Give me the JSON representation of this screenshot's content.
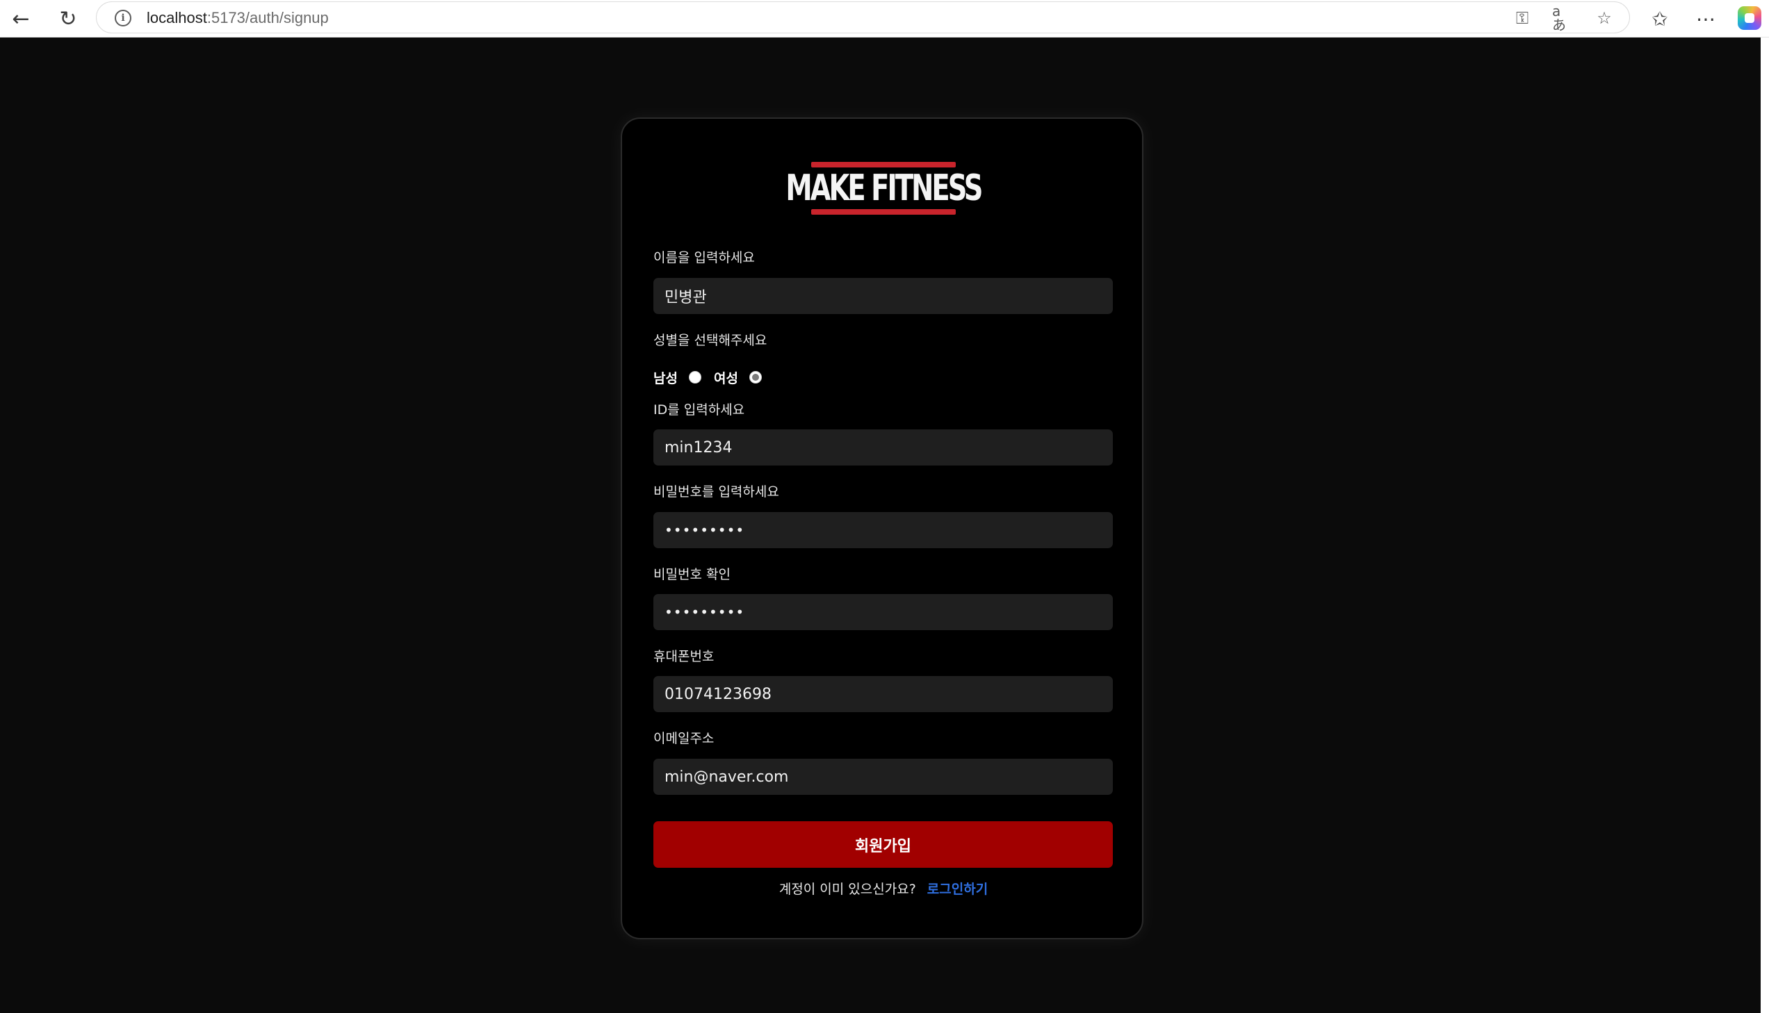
{
  "browser": {
    "url_host": "localhost",
    "url_path": ":5173/auth/signup",
    "back_icon": "back-arrow-icon",
    "reload_icon": "reload-icon",
    "info_glyph": "i"
  },
  "logo": {
    "text": "MAKE FITNESS",
    "accent_color": "#c9242c"
  },
  "form": {
    "name": {
      "label": "이름을 입력하세요",
      "value": "민병관"
    },
    "gender": {
      "label": "성별을 선택해주세요",
      "male_label": "남성",
      "female_label": "여성",
      "selected": "여성"
    },
    "id": {
      "label": "ID를 입력하세요",
      "value": "min1234"
    },
    "password": {
      "label": "비밀번호를 입력하세요",
      "value": "•••••••••"
    },
    "password_confirm": {
      "label": "비밀번호 확인",
      "value": "•••••••••"
    },
    "phone": {
      "label": "휴대폰번호",
      "value": "01074123698"
    },
    "email": {
      "label": "이메일주소",
      "value": "min@naver.com"
    },
    "submit_label": "회원가입",
    "submit_color": "#a10000"
  },
  "footer": {
    "question": "계정이 이미 있으신가요?",
    "login_link": "로그인하기",
    "link_color": "#2f6fe0"
  }
}
